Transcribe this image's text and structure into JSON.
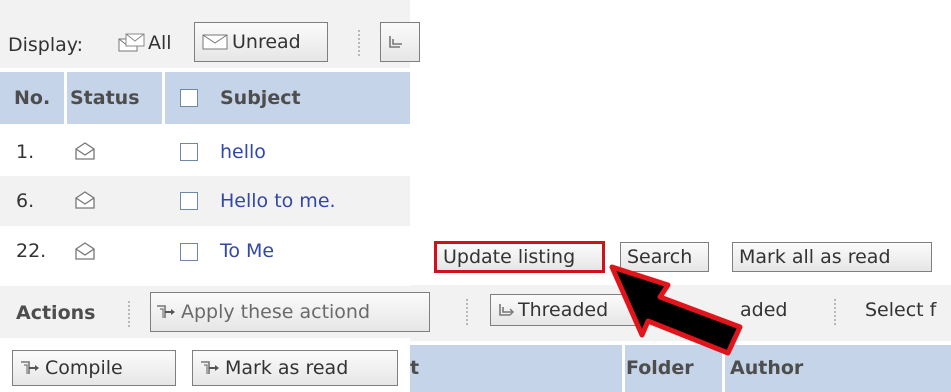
{
  "display_bar": {
    "label": "Display:",
    "all_label": "All",
    "unread_label": "Unread"
  },
  "table": {
    "headers": {
      "no": "No.",
      "status": "Status",
      "subject": "Subject"
    },
    "rows": [
      {
        "no": "1.",
        "subject": "hello"
      },
      {
        "no": "6.",
        "subject": "Hello to me."
      },
      {
        "no": "22.",
        "subject": "To Me"
      }
    ]
  },
  "actions_bar": {
    "label": "Actions",
    "apply_label": "Apply these actiond"
  },
  "bottom_buttons": {
    "compile_label": "Compile",
    "mark_read_label": "Mark as read"
  },
  "right_panel": {
    "update_label": "Update listing",
    "search_label": "Search",
    "mark_all_label": "Mark all as read",
    "threaded_label": "Threaded",
    "unthreaded_fragment": "aded",
    "select_fragment": "Select f",
    "header_fragment": "t",
    "folder_header": "Folder",
    "author_header": "Author"
  },
  "colors": {
    "header_bg": "#c5d4e8",
    "band_bg": "#f2f2f2",
    "link": "#3347a6",
    "highlight_border": "#d0101a",
    "arrow_red": "#e0151b"
  }
}
